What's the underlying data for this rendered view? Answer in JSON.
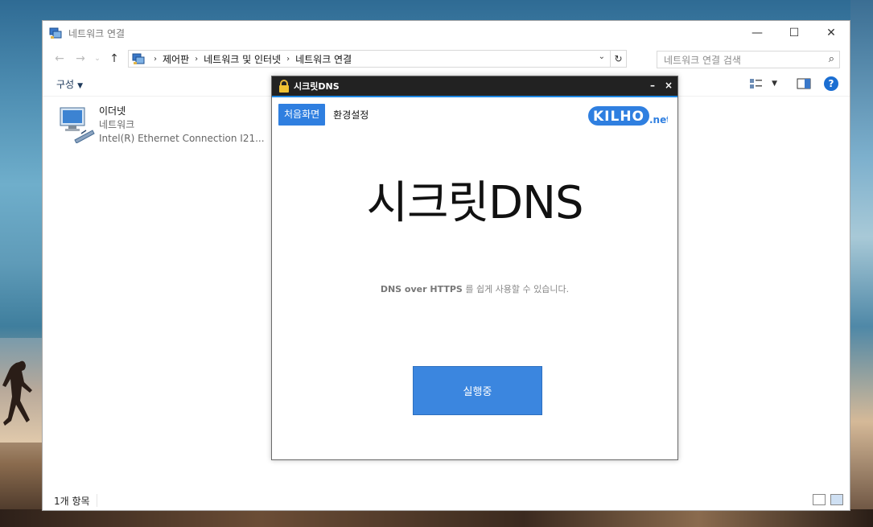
{
  "explorer": {
    "title": "네트워크 연결",
    "breadcrumb": [
      "제어판",
      "네트워크 및 인터넷",
      "네트워크 연결"
    ],
    "search_placeholder": "네트워크 연결 검색",
    "organize_label": "구성",
    "item": {
      "name": "이더넷",
      "type": "네트워크",
      "adapter": "Intel(R) Ethernet Connection I21..."
    },
    "status_count": "1개 항목"
  },
  "secretdns": {
    "title": "시크릿DNS",
    "tabs": [
      "처음화면",
      "환경설정"
    ],
    "logo_text": "KILHO",
    "logo_suffix": ".net",
    "heading": "시크릿DNS",
    "subtitle_bold": "DNS over HTTPS",
    "subtitle_rest": " 를 쉽게 사용할 수 있습니다.",
    "run_button": "실행중"
  },
  "colors": {
    "accent": "#3b86df",
    "titlebar": "#222222",
    "help": "#1b6ed2"
  }
}
